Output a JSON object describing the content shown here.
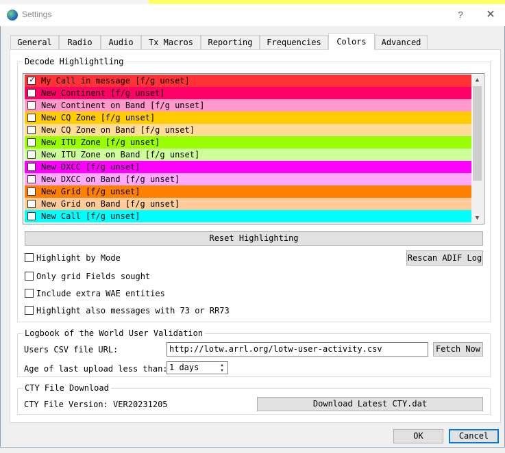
{
  "window": {
    "title": "Settings",
    "help_label": "?",
    "close_label": "✕"
  },
  "tabs": [
    {
      "label": "General",
      "active": false
    },
    {
      "label": "Radio",
      "active": false
    },
    {
      "label": "Audio",
      "active": false
    },
    {
      "label": "Tx Macros",
      "active": false
    },
    {
      "label": "Reporting",
      "active": false
    },
    {
      "label": "Frequencies",
      "active": false
    },
    {
      "label": "Colors",
      "active": true
    },
    {
      "label": "Advanced",
      "active": false
    }
  ],
  "decode_highlighting": {
    "title": "Decode Highlightling",
    "items": [
      {
        "label": "My Call in message [f/g unset]",
        "checked": true,
        "color": "#ff3333"
      },
      {
        "label": "New Continent [f/g unset]",
        "checked": false,
        "color": "#ff0066"
      },
      {
        "label": "New Continent on Band [f/g unset]",
        "checked": false,
        "color": "#ff99cc"
      },
      {
        "label": "New CQ Zone [f/g unset]",
        "checked": false,
        "color": "#ffcc00"
      },
      {
        "label": "New CQ Zone on Band [f/g unset]",
        "checked": false,
        "color": "#ffdd99"
      },
      {
        "label": "New ITU Zone [f/g unset]",
        "checked": false,
        "color": "#99ff00"
      },
      {
        "label": "New ITU Zone on Band [f/g unset]",
        "checked": false,
        "color": "#ccff99"
      },
      {
        "label": "New DXCC [f/g unset]",
        "checked": false,
        "color": "#ff00ff"
      },
      {
        "label": "New DXCC on Band [f/g unset]",
        "checked": false,
        "color": "#ffaaff"
      },
      {
        "label": "New Grid [f/g unset]",
        "checked": false,
        "color": "#ff8000"
      },
      {
        "label": "New Grid on Band [f/g unset]",
        "checked": false,
        "color": "#ffcc99"
      },
      {
        "label": "New Call [f/g unset]",
        "checked": false,
        "color": "#00ffff"
      }
    ],
    "reset_button": "Reset Highlighting",
    "rescan_button": "Rescan ADIF Log",
    "options": [
      {
        "label": "Highlight by Mode",
        "checked": false
      },
      {
        "label": "Only grid Fields sought",
        "checked": false
      },
      {
        "label": "Include extra WAE entities",
        "checked": false
      },
      {
        "label": "Highlight also messages with 73 or RR73",
        "checked": false
      }
    ]
  },
  "lotw": {
    "title": "Logbook of the World User Validation",
    "url_label": "Users CSV file URL:",
    "url_value": "http://lotw.arrl.org/lotw-user-activity.csv",
    "fetch_button": "Fetch Now",
    "age_label": "Age of last upload less than:",
    "age_value": "1 days"
  },
  "cty": {
    "title": "CTY File Download",
    "version_label": "CTY File Version: VER20231205",
    "download_button": "Download Latest CTY.dat"
  },
  "footer": {
    "ok": "OK",
    "cancel": "Cancel"
  }
}
